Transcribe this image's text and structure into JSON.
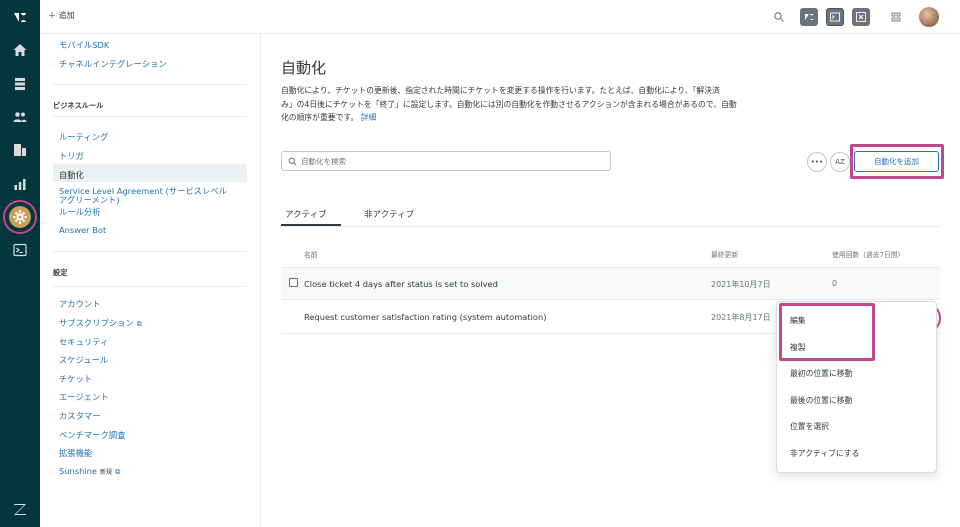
{
  "colors": {
    "rail_bg": "#03363d",
    "link": "#1f73b7",
    "highlight": "#c2488e",
    "active_icon_bg": "#c8a25c"
  },
  "rail": {
    "icons": [
      "zendesk-logo-icon",
      "home-icon",
      "views-icon",
      "customers-icon",
      "organizations-icon",
      "reporting-icon",
      "settings-gear-icon",
      "terminal-app-icon",
      "zendesk-z-icon"
    ]
  },
  "topbar": {
    "add_label": "＋ 追加",
    "icons": [
      "search-icon",
      "support-product-icon",
      "terminal-product-icon",
      "close-product-icon",
      "apps-grid-icon"
    ]
  },
  "sidebar": {
    "top_links": [
      "モバイルSDK",
      "チャネルインテグレーション"
    ],
    "business_rules_heading": "ビジネスルール",
    "business_rules": [
      "ルーティング",
      "トリガ",
      "自動化",
      "Service Level Agreement (サービスレベル",
      "アグリーメント)",
      "ルール分析",
      "Answer Bot"
    ],
    "settings_heading": "設定",
    "settings": [
      "アカウント",
      "サブスクリプション",
      "セキュリティ",
      "スケジュール",
      "チケット",
      "エージェント",
      "カスタマー",
      "ベンチマーク調査",
      "拡張機能",
      "Sunshine"
    ],
    "new_badge": "新規"
  },
  "main": {
    "title": "自動化",
    "description_line1": "自動化により、チケットの更新後、指定された時間にチケットを変更する操作を行います。たとえば、自動化により、「解決済",
    "description_line2": "み」の4日後にチケットを「終了」に設定します。自動化には別の自動化を作動させるアクションが含まれる場合があるので、自動",
    "description_line3": "化の順序が重要です。",
    "details_link": "詳細",
    "search_placeholder": "自動化を検索",
    "more_label": "•••",
    "sort_label": "AZ",
    "add_button": "自動化を追加",
    "tabs": [
      "アクティブ",
      "非アクティブ"
    ],
    "columns": {
      "name": "名前",
      "updated": "最終更新",
      "usage": "使用回数（過去7日間)"
    },
    "rows": [
      {
        "name": "Close ticket 4 days after status is set to solved",
        "updated": "2021年10月7日",
        "usage": "0"
      },
      {
        "name": "Request customer satisfaction rating (system automation)",
        "updated": "2021年8月17日",
        "usage": ""
      }
    ],
    "menu": [
      "編集",
      "複製",
      "最初の位置に移動",
      "最後の位置に移動",
      "位置を選択",
      "非アクティブにする"
    ]
  }
}
